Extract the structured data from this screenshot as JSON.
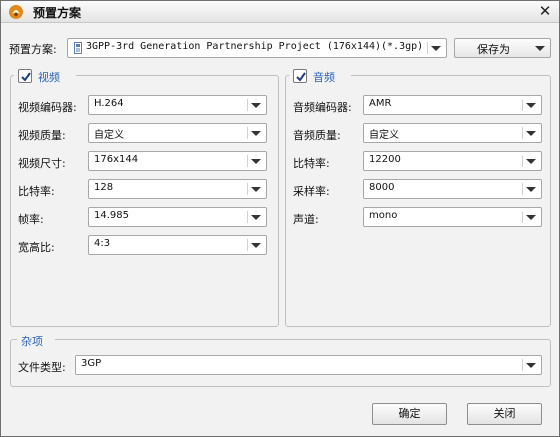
{
  "window": {
    "title": "预置方案",
    "close_glyph": "✕"
  },
  "preset": {
    "label": "预置方案:",
    "value": "3GPP-3rd Generation Partnership Project (176x144)(*.3gp)",
    "save_as": "保存为"
  },
  "video": {
    "title": "视频",
    "enabled": true,
    "fields": [
      {
        "label": "视频编码器:",
        "value": "H.264"
      },
      {
        "label": "视频质量:",
        "value": "自定义"
      },
      {
        "label": "视频尺寸:",
        "value": "176x144"
      },
      {
        "label": "比特率:",
        "value": "128"
      },
      {
        "label": "帧率:",
        "value": "14.985"
      },
      {
        "label": "宽高比:",
        "value": "4:3"
      }
    ]
  },
  "audio": {
    "title": "音频",
    "enabled": true,
    "fields": [
      {
        "label": "音频编码器:",
        "value": "AMR"
      },
      {
        "label": "音频质量:",
        "value": "自定义"
      },
      {
        "label": "比特率:",
        "value": "12200"
      },
      {
        "label": "采样率:",
        "value": "8000"
      },
      {
        "label": "声道:",
        "value": "mono"
      }
    ]
  },
  "misc": {
    "title": "杂项",
    "file_type_label": "文件类型:",
    "file_type_value": "3GP"
  },
  "buttons": {
    "ok": "确定",
    "close": "关闭"
  },
  "colors": {
    "group_title": "#2a62b8",
    "window_bg": "#f2f2f2"
  },
  "icons": {
    "app": "app-logo-icon",
    "preset_file": "document-icon",
    "check": "checkmark-icon",
    "close": "close-icon",
    "dropdown": "chevron-down-icon"
  }
}
